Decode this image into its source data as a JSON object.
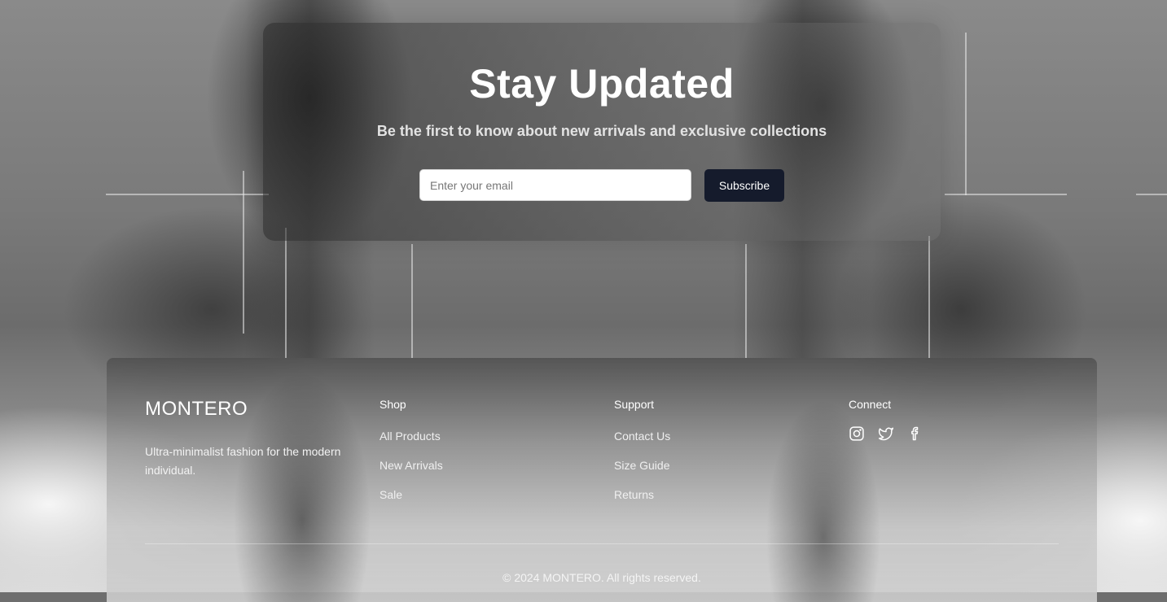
{
  "newsletter": {
    "title": "Stay Updated",
    "subtitle": "Be the first to know about new arrivals and exclusive collections",
    "email_placeholder": "Enter your email",
    "subscribe_label": "Subscribe"
  },
  "footer": {
    "brand": "MONTERO",
    "tagline": "Ultra-minimalist fashion for the modern individual.",
    "columns": [
      {
        "heading": "Shop",
        "links": [
          "All Products",
          "New Arrivals",
          "Sale"
        ]
      },
      {
        "heading": "Support",
        "links": [
          "Contact Us",
          "Size Guide",
          "Returns"
        ]
      },
      {
        "heading": "Connect",
        "icons": [
          "instagram-icon",
          "twitter-icon",
          "facebook-icon"
        ]
      }
    ],
    "copyright": "© 2024 MONTERO. All rights reserved."
  },
  "colors": {
    "button_bg": "#151b2c",
    "text_light": "#ffffff"
  }
}
